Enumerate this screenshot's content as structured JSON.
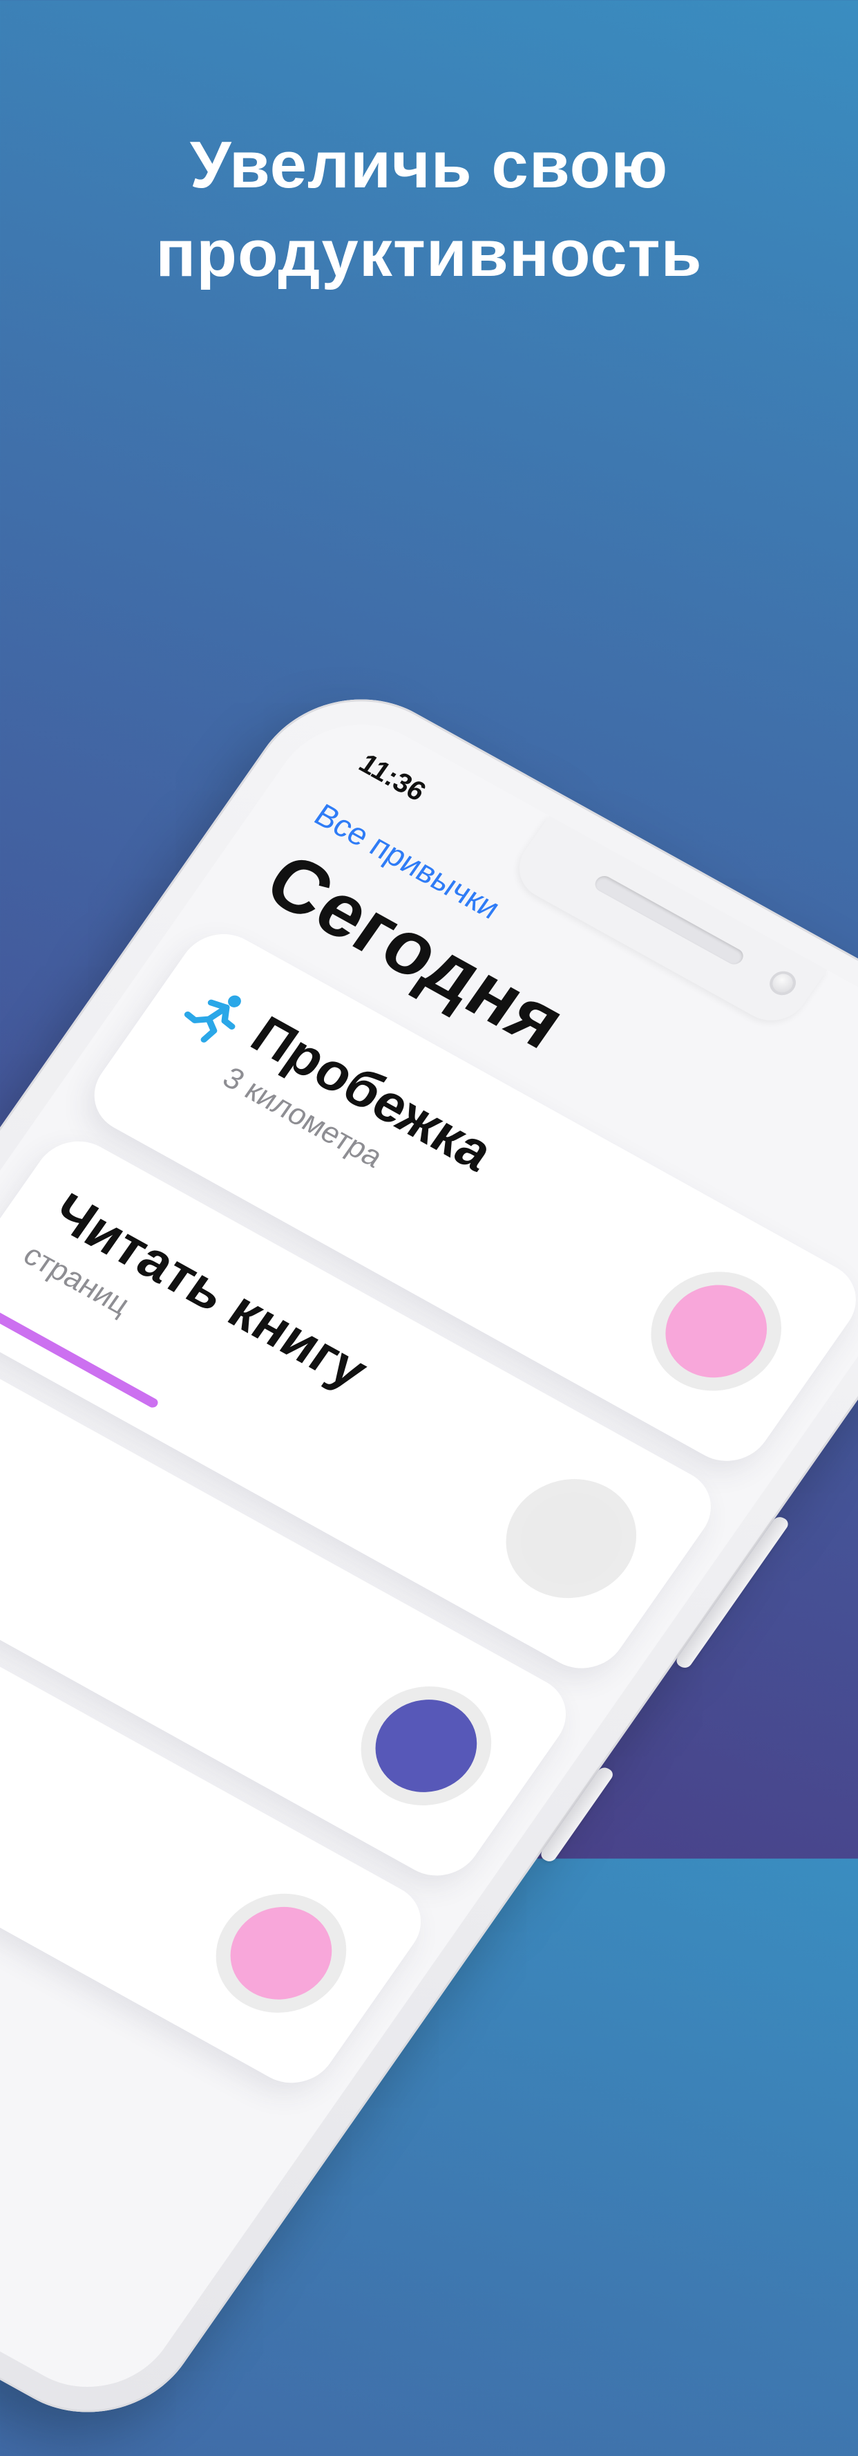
{
  "headline": {
    "line1": "Увеличь свою",
    "line2": "продуктивность"
  },
  "phone": {
    "status_time": "11:36",
    "back_link": "Все привычки",
    "title": "Сегодня",
    "habits": [
      {
        "title": "Пробежка",
        "subtitle": "3 километра",
        "icon": "running-person-icon",
        "icon_color": "#2aa7e8",
        "dot_color": "#f8a7da"
      },
      {
        "title": "Читать книгу",
        "subtitle": "страниц",
        "dot_color": "#ebebeb",
        "progress_color": "#cc70f0",
        "progress": 0.4
      },
      {
        "title": "",
        "subtitle": "",
        "dot_color": "#5758b8"
      },
      {
        "title": "",
        "subtitle": "",
        "dot_color": "#f8a7da"
      }
    ]
  }
}
